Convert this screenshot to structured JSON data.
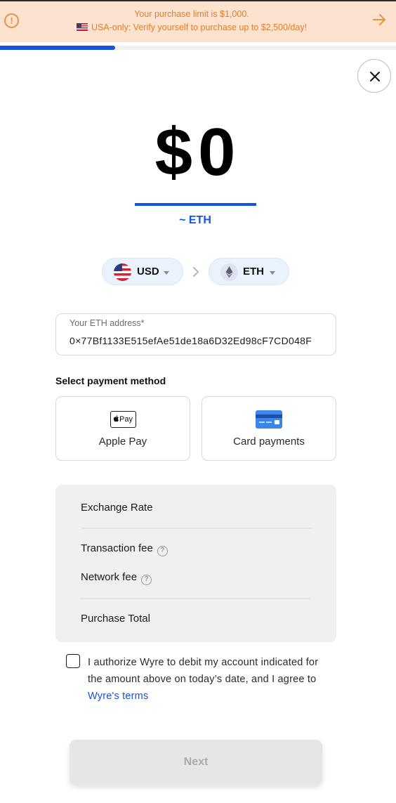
{
  "banner": {
    "limit_text": "Your purchase limit is $1,000.",
    "verify_text": "USA-only: Verify yourself to purchase up to $2,500/day!"
  },
  "progress": {
    "fraction": 0.29
  },
  "amount": {
    "value": "$0",
    "estimate": "~ ETH"
  },
  "currency": {
    "source": "USD",
    "target": "ETH"
  },
  "address": {
    "label": "Your ETH address*",
    "value": "0×77Bf1133E515efAe51de18a6D32Ed98cF7CD048F"
  },
  "payment": {
    "title": "Select payment method",
    "methods": [
      {
        "label": "Apple Pay",
        "icon": "apple-pay-icon",
        "badge": "Pay"
      },
      {
        "label": "Card payments",
        "icon": "credit-card-icon"
      }
    ]
  },
  "summary": {
    "exchange_rate": "Exchange Rate",
    "transaction_fee": "Transaction fee",
    "network_fee": "Network fee",
    "purchase_total": "Purchase Total",
    "help_glyph": "?"
  },
  "consent": {
    "text": "I authorize Wyre to debit my account indicated for the amount above on today’s date, and I agree to ",
    "terms_link": "Wyre's terms"
  },
  "next_label": "Next",
  "colors": {
    "accent": "#1554e0",
    "banner_bg": "#fde3cf",
    "banner_text": "#e07d26",
    "pill_bg": "#eaf2fb"
  }
}
